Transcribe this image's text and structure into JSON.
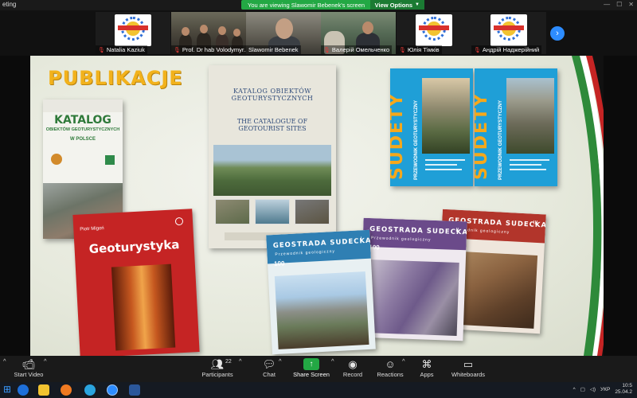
{
  "window": {
    "title_fragment": "eting",
    "share_banner": "You are viewing Slawomir Bebenek's screen",
    "view_options": "View Options"
  },
  "participants": [
    {
      "name": "Natalia Kaziuk",
      "muted": true,
      "kind": "logo"
    },
    {
      "name": "Prof. Dr hab Volodymyr...",
      "muted": true,
      "kind": "camera"
    },
    {
      "name": "Slawomir Bebenek",
      "muted": false,
      "kind": "camera"
    },
    {
      "name": "Валерій Омельченко",
      "muted": true,
      "kind": "camera"
    },
    {
      "name": "Юлія Тімків",
      "muted": true,
      "kind": "logo"
    },
    {
      "name": "Андрій Наджерійний",
      "muted": true,
      "kind": "logo"
    }
  ],
  "slide": {
    "title": "PUBLIKACJE",
    "books": {
      "katalog_pl": {
        "title": "KATALOG",
        "subtitle": "OBIEKTÓW GEOTURYSTYCZNYCH",
        "subtitle2": "W POLSCE"
      },
      "catalogue": {
        "title1": "KATALOG OBIEKTÓW GEOTURYSTYCZNYCH",
        "title2": "THE CATALOGUE OF GEOTOURIST SITES"
      },
      "geoturystyka": {
        "author": "Piotr Migoń",
        "title": "Geoturystyka"
      },
      "sudety1": {
        "title": "SUDETY",
        "sub": "PRZEWODNIK GEOTURYSTYCZNY"
      },
      "sudety2": {
        "title": "SUDETY",
        "sub": "PRZEWODNIK GEOTURYSTYCZNY"
      },
      "geostrada1": {
        "title": "GEOSTRADA SUDECKA",
        "sub": "Przewodnik geologiczny",
        "volume": "I"
      },
      "geostrada2": {
        "title": "GEOSTRADA SUDECKA",
        "sub": "Przewodnik geologiczny",
        "volume": "II"
      },
      "geostrada3": {
        "title": "GEOSTRADA SUDECKA",
        "sub": "Przewodnik geologiczny",
        "volume": "III"
      }
    }
  },
  "toolbar": {
    "start_video": "Start Video",
    "participants": "Participants",
    "participants_count": "22",
    "chat": "Chat",
    "share_screen": "Share Screen",
    "record": "Record",
    "reactions": "Reactions",
    "apps": "Apps",
    "whiteboards": "Whiteboards"
  },
  "taskbar": {
    "language": "УКР",
    "time": "10:5",
    "date": "25.04.2"
  },
  "colors": {
    "accent_green": "#23a844",
    "accent_blue": "#2d8cff",
    "slide_title": "#f2b21c"
  }
}
